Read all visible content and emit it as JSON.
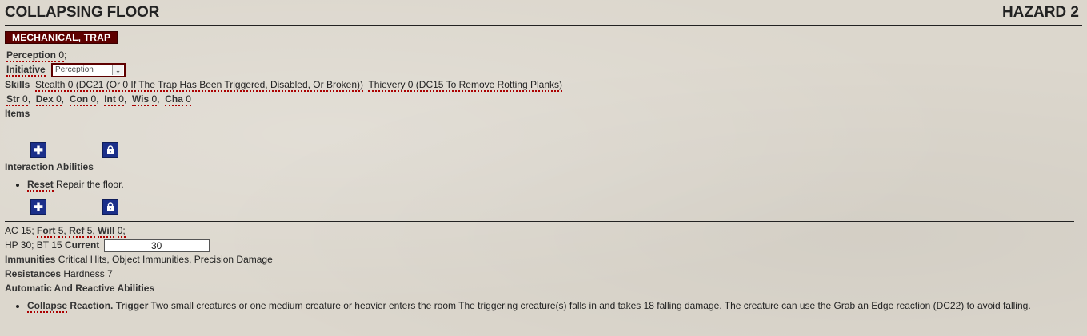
{
  "header": {
    "title": "COLLAPSING FLOOR",
    "level": "HAZARD 2"
  },
  "traits": {
    "label": "MECHANICAL, TRAP"
  },
  "perception": {
    "label": "Perception",
    "value": "0",
    "sep": ";"
  },
  "initiative": {
    "label": "Initiative",
    "selected": "Perception"
  },
  "skills": {
    "label": "Skills",
    "stealth": "Stealth 0 (DC21 (Or 0 If The Trap Has Been Triggered, Disabled, Or Broken))",
    "thievery": "Thievery 0 (DC15 To Remove Rotting Planks)"
  },
  "abilities": [
    {
      "label": "Str",
      "value": "0",
      "sep": ","
    },
    {
      "label": "Dex",
      "value": "0",
      "sep": ","
    },
    {
      "label": "Con",
      "value": "0",
      "sep": ","
    },
    {
      "label": "Int",
      "value": "0",
      "sep": ","
    },
    {
      "label": "Wis",
      "value": "0",
      "sep": ","
    },
    {
      "label": "Cha",
      "value": "0",
      "sep": ""
    }
  ],
  "items": {
    "label": "Items"
  },
  "interaction": {
    "label": "Interaction Abilities",
    "reset_name": "Reset",
    "reset_text": "Repair the floor."
  },
  "defense": {
    "ac": "AC 15;",
    "fort": "Fort",
    "fort_val": "5,",
    "ref": "Ref",
    "ref_val": "5,",
    "will": "Will",
    "will_val": "0;"
  },
  "hp": {
    "text": "HP 30; BT 15",
    "current_label": "Current",
    "current_value": "30"
  },
  "immunities": {
    "label": "Immunities",
    "text": "Critical Hits, Object Immunities, Precision Damage"
  },
  "resistances": {
    "label": "Resistances",
    "text": "Hardness 7"
  },
  "automatic": {
    "label": "Automatic And Reactive Abilities",
    "name": "Collapse",
    "type": "Reaction.",
    "trigger_label": "Trigger",
    "text": "Two small creatures or one medium creature or heavier enters the room The triggering creature(s) falls in and takes 18 falling damage. The creature can use the Grab an Edge reaction (DC22) to avoid falling."
  },
  "icons": {
    "add": "plus-icon",
    "lock": "lock-icon"
  },
  "colors": {
    "trait_bg": "#5e0000",
    "button_bg": "#1b2f8a",
    "dotted": "#aa0000"
  }
}
